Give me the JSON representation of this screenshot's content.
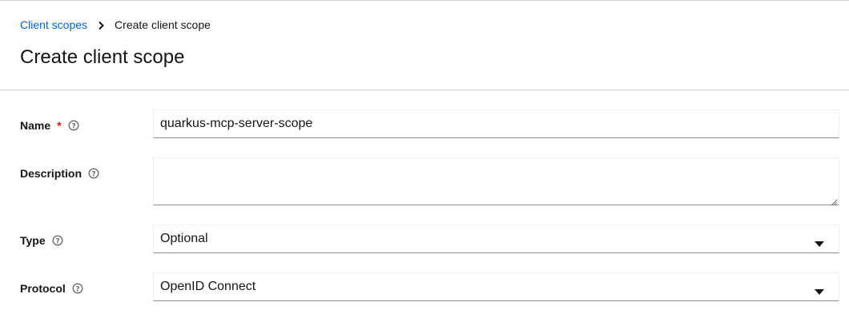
{
  "breadcrumb": {
    "parent": "Client scopes",
    "current": "Create client scope"
  },
  "page": {
    "title": "Create client scope"
  },
  "form": {
    "name": {
      "label": "Name",
      "required_marker": "*",
      "value": "quarkus-mcp-server-scope"
    },
    "description": {
      "label": "Description",
      "value": ""
    },
    "type": {
      "label": "Type",
      "selected": "Optional"
    },
    "protocol": {
      "label": "Protocol",
      "selected": "OpenID Connect"
    }
  },
  "icons": {
    "breadcrumb_separator": "chevron-right-icon",
    "help": "help-circle-icon",
    "select_toggle": "caret-down-icon",
    "resize": "resize-grip-icon"
  },
  "colors": {
    "link": "#0066cc",
    "required": "#c9190b",
    "text": "#151515",
    "border": "#8a8d90"
  }
}
